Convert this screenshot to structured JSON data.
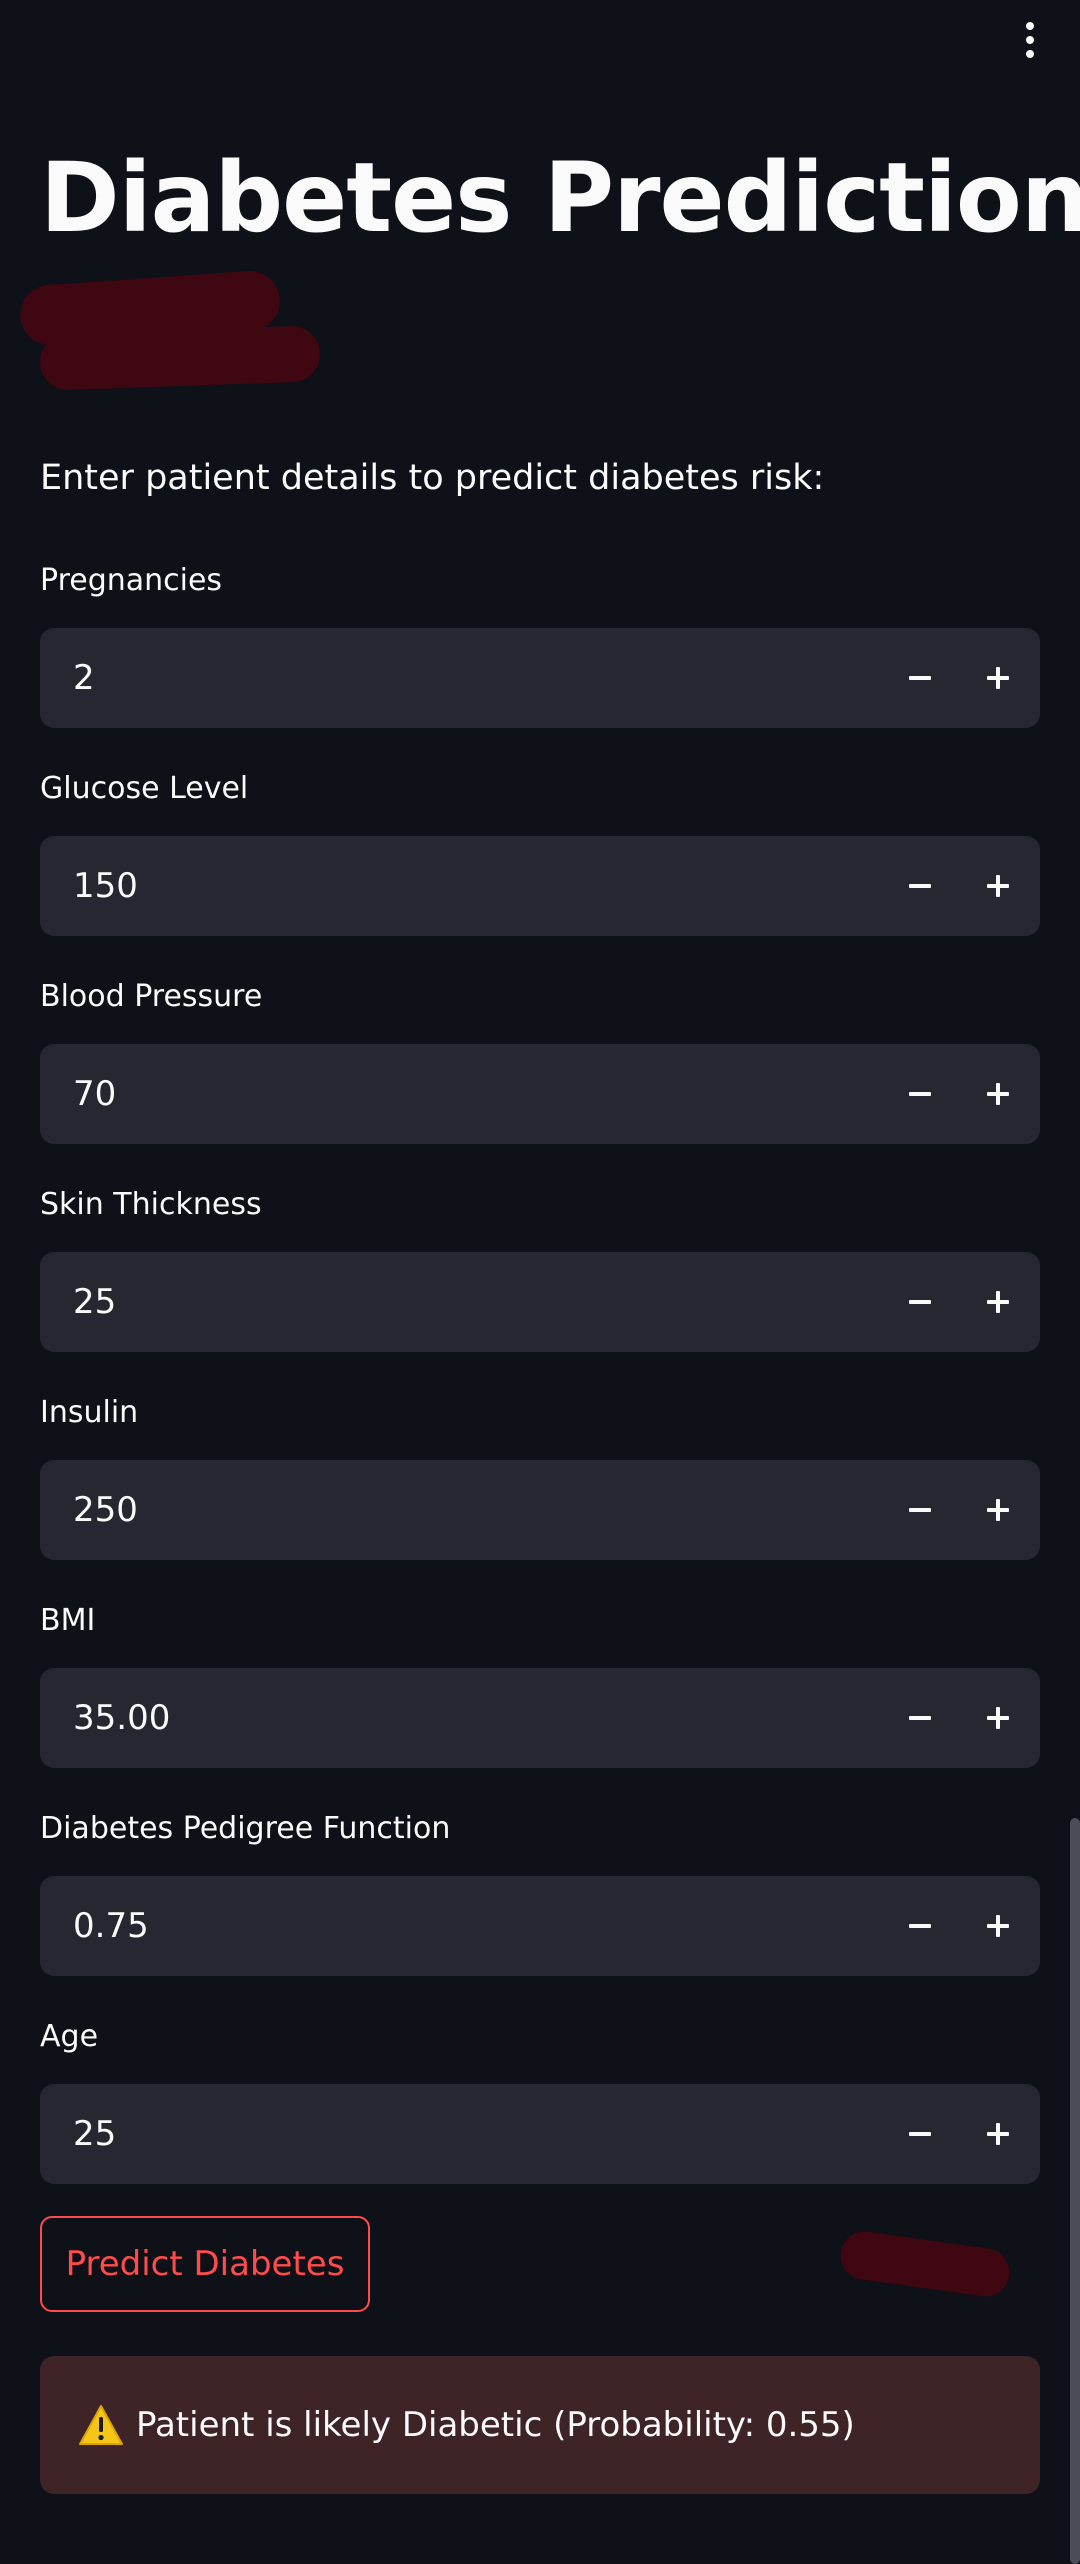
{
  "header": {
    "menu_icon": "vertical-ellipsis-icon"
  },
  "page": {
    "title": "Diabetes Prediction",
    "subtitle": "Enter patient details to predict diabetes risk:"
  },
  "fields": [
    {
      "label": "Pregnancies",
      "value": "2"
    },
    {
      "label": "Glucose Level",
      "value": "150"
    },
    {
      "label": "Blood Pressure",
      "value": "70"
    },
    {
      "label": "Skin Thickness",
      "value": "25"
    },
    {
      "label": "Insulin",
      "value": "250"
    },
    {
      "label": "BMI",
      "value": "35.00"
    },
    {
      "label": "Diabetes Pedigree Function",
      "value": "0.75"
    },
    {
      "label": "Age",
      "value": "25"
    }
  ],
  "stepper_icons": {
    "decrement": "minus-icon",
    "increment": "plus-icon"
  },
  "actions": {
    "predict_label": "Predict Diabetes"
  },
  "result": {
    "icon": "warning-icon",
    "message": "Patient is likely Diabetic (Probability: 0.55)"
  },
  "colors": {
    "background": "#0e1117",
    "input_background": "#262730",
    "accent": "#ff4b4b",
    "alert_background": "#3e2327",
    "warning_yellow": "#f5c518"
  }
}
